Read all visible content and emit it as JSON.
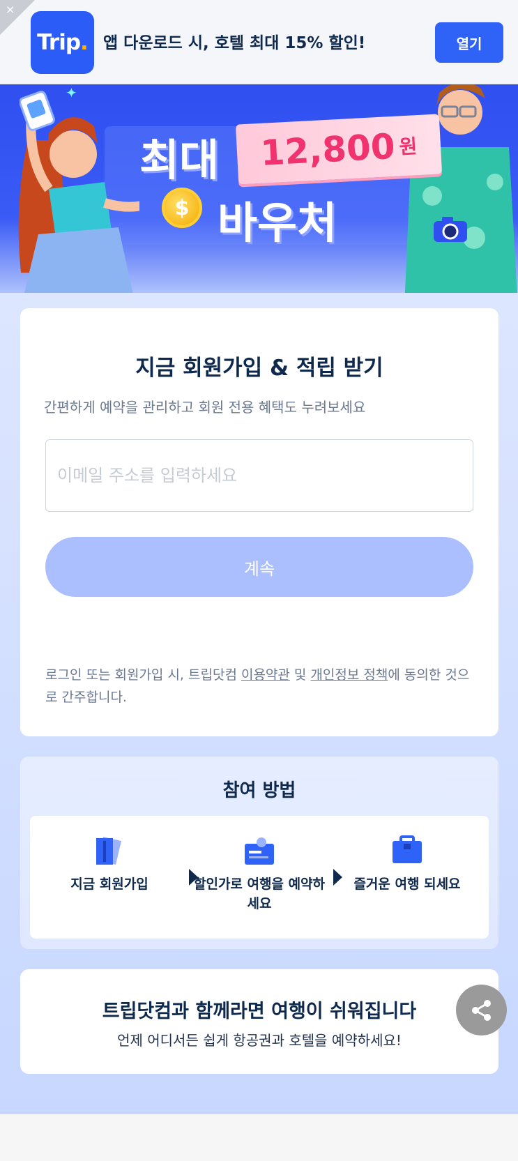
{
  "app_banner": {
    "close_label": "×",
    "logo_text": "Trip",
    "logo_dot": ".",
    "message": "앱 다운로드 시, 호텔 최대 15% 할인!",
    "open_label": "열기"
  },
  "hero": {
    "line1": "최대",
    "amount": "12,800",
    "unit": "원",
    "line2": "바우처",
    "coin_symbol": "$"
  },
  "signup": {
    "title": "지금 회원가입 & 적립 받기",
    "subtitle": "간편하게 예약을 관리하고 회원 전용 혜택도 누려보세요",
    "email_placeholder": "이메일 주소를 입력하세요",
    "continue_label": "계속",
    "terms_prefix": "로그인 또는 회원가입 시, 트립닷컴 ",
    "terms_link": "이용약관",
    "terms_and": " 및 ",
    "privacy_link": "개인정보 정책",
    "terms_suffix": "에 동의한 것으로 간주합니다."
  },
  "howto": {
    "title": "참여 방법",
    "steps": [
      {
        "label": "지금 회원가입",
        "icon": "ticket-icon"
      },
      {
        "label": "할인가로 여행을 예약하세요",
        "icon": "booking-card-icon"
      },
      {
        "label": "즐거운 여행 되세요",
        "icon": "suitcase-icon"
      }
    ]
  },
  "promo": {
    "title": "트립닷컴과 함께라면 여행이 쉬워집니다",
    "subtitle": "언제 어디서든 쉽게 항공권과 호텔을 예약하세요!"
  },
  "colors": {
    "brand_blue": "#2f63f7",
    "continue_disabled": "#abbffe",
    "voucher_pink": "#f0336e",
    "text_dark": "#0f294d"
  }
}
